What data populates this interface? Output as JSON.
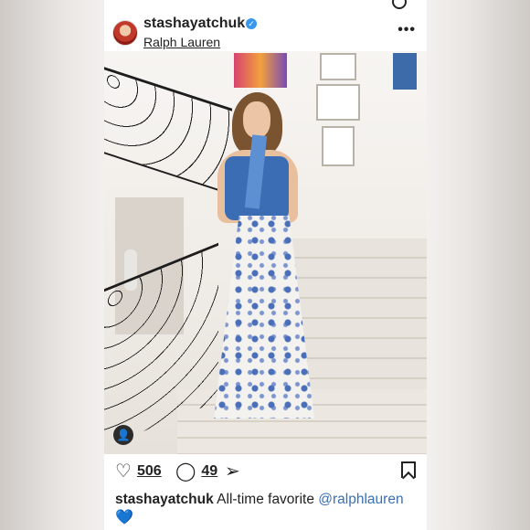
{
  "post": {
    "username": "stashayatchuk",
    "verified_badge": "✓",
    "location": "Ralph Lauren",
    "more_label": "•••",
    "likes": "506",
    "comments": "49",
    "caption_user": "stashayatchuk",
    "caption_text": "All-time favorite",
    "caption_mention": "@ralphlauren",
    "caption_emoji": "💙"
  },
  "icons": {
    "heart": "♡",
    "comment": "◯",
    "share": "➢",
    "user_tag": "👤"
  },
  "colors": {
    "verified": "#3897f0",
    "mention": "#3b6fb5"
  }
}
